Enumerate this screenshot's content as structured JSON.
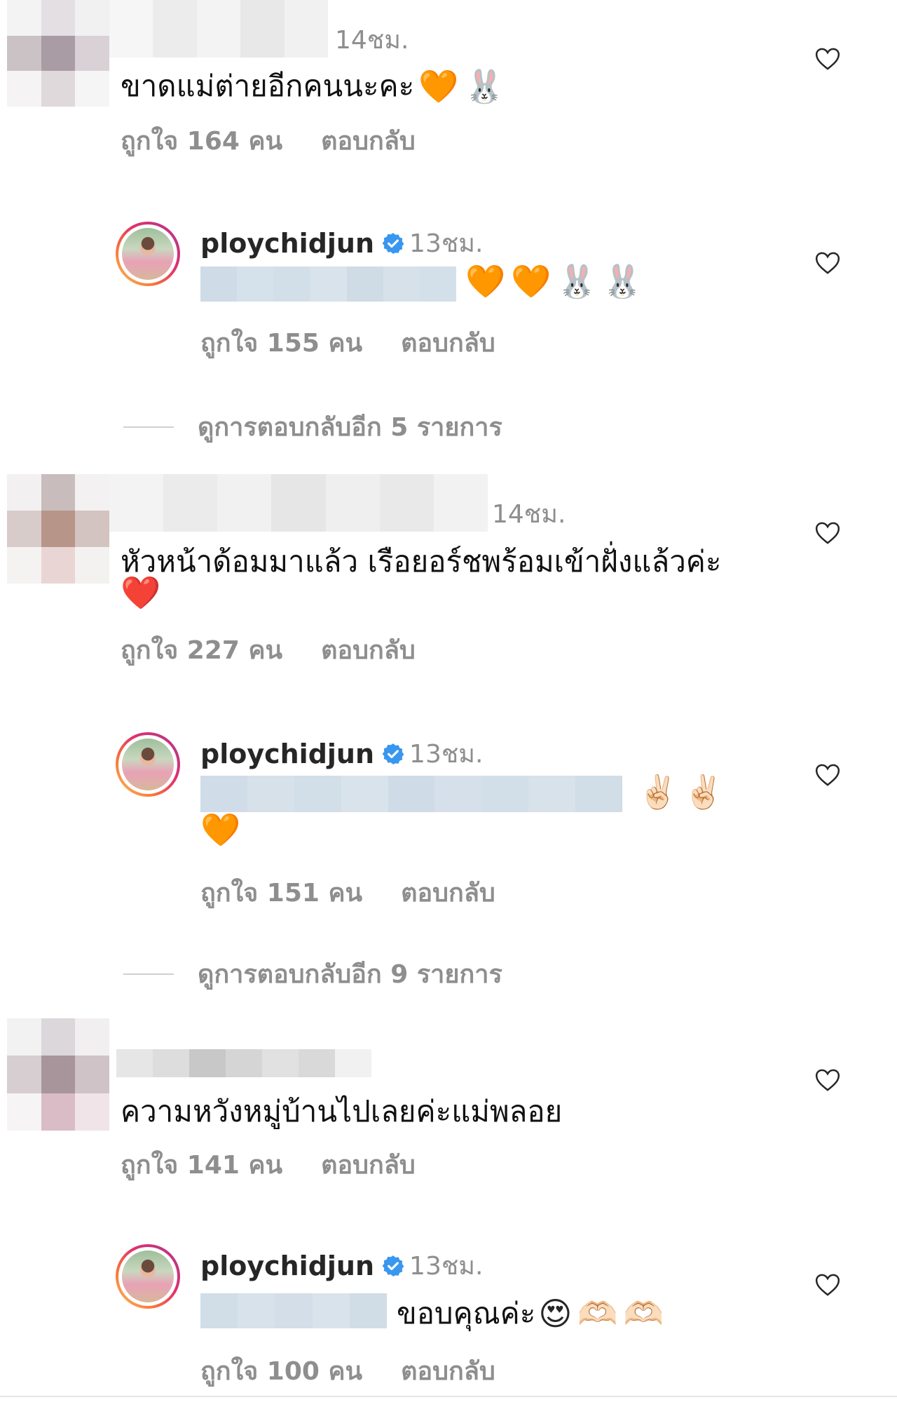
{
  "comments": [
    {
      "time": "14ชม.",
      "text": "ขาดแม่ต่ายอีกคนนะคะ",
      "emoji": "🧡🐰",
      "likes": "ถูกใจ 164 คน",
      "reply_label": "ตอบกลับ",
      "reply": {
        "username": "ploychidjun",
        "time": "13ชม.",
        "emoji": "🧡🧡🐰🐰",
        "likes": "ถูกใจ 155 คน",
        "reply_label": "ตอบกลับ"
      },
      "view_more": "ดูการตอบกลับอีก 5 รายการ"
    },
    {
      "time": "14ชม.",
      "text": "หัวหน้าด้อมมาแล้ว เรือยอร์ชพร้อมเข้าฝั่งแล้วค่ะ",
      "emoji": "❤️",
      "likes": "ถูกใจ 227 คน",
      "reply_label": "ตอบกลับ",
      "reply": {
        "username": "ploychidjun",
        "time": "13ชม.",
        "emoji": "✌🏻✌🏻",
        "emoji2": "🧡",
        "likes": "ถูกใจ 151 คน",
        "reply_label": "ตอบกลับ"
      },
      "view_more": "ดูการตอบกลับอีก 9 รายการ"
    },
    {
      "text": "ความหวังหมู่บ้านไปเลยค่ะแม่พลอย",
      "likes": "ถูกใจ 141 คน",
      "reply_label": "ตอบกลับ",
      "reply": {
        "username": "ploychidjun",
        "time": "13ชม.",
        "text": "ขอบคุณค่ะ",
        "emoji": "😍🫶🏻🫶🏻",
        "likes": "ถูกใจ 100 คน",
        "reply_label": "ตอบกลับ"
      }
    }
  ],
  "colors": {
    "text": "#262626",
    "meta": "#8e8e8e",
    "verified": "#3897f0"
  }
}
